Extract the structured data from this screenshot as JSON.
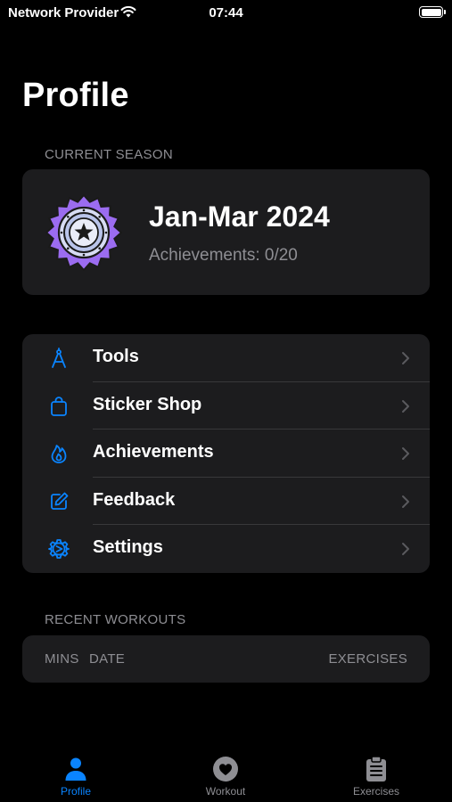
{
  "status_bar": {
    "carrier": "Network Provider",
    "time": "07:44"
  },
  "page": {
    "title": "Profile"
  },
  "current_season": {
    "section_label": "CURRENT SEASON",
    "name": "Jan-Mar 2024",
    "achievements": "Achievements: 0/20"
  },
  "menu": {
    "items": [
      {
        "label": "Tools",
        "icon": "compass-tool-icon"
      },
      {
        "label": "Sticker Shop",
        "icon": "shopping-bag-icon"
      },
      {
        "label": "Achievements",
        "icon": "flame-icon"
      },
      {
        "label": "Feedback",
        "icon": "edit-square-icon"
      },
      {
        "label": "Settings",
        "icon": "gear-icon"
      }
    ]
  },
  "recent_workouts": {
    "section_label": "RECENT WORKOUTS",
    "columns": {
      "mins": "MINS",
      "date": "DATE",
      "exercises": "EXERCISES"
    }
  },
  "tab_bar": {
    "tabs": [
      {
        "label": "Profile",
        "icon": "person-icon",
        "active": true
      },
      {
        "label": "Workout",
        "icon": "heart-circle-icon",
        "active": false
      },
      {
        "label": "Exercises",
        "icon": "clipboard-icon",
        "active": false
      }
    ]
  },
  "colors": {
    "accent": "#0a84ff",
    "background": "#000000",
    "card": "#1c1c1e",
    "secondary_text": "#8e8e93",
    "badge_purple": "#9b6cf0"
  }
}
